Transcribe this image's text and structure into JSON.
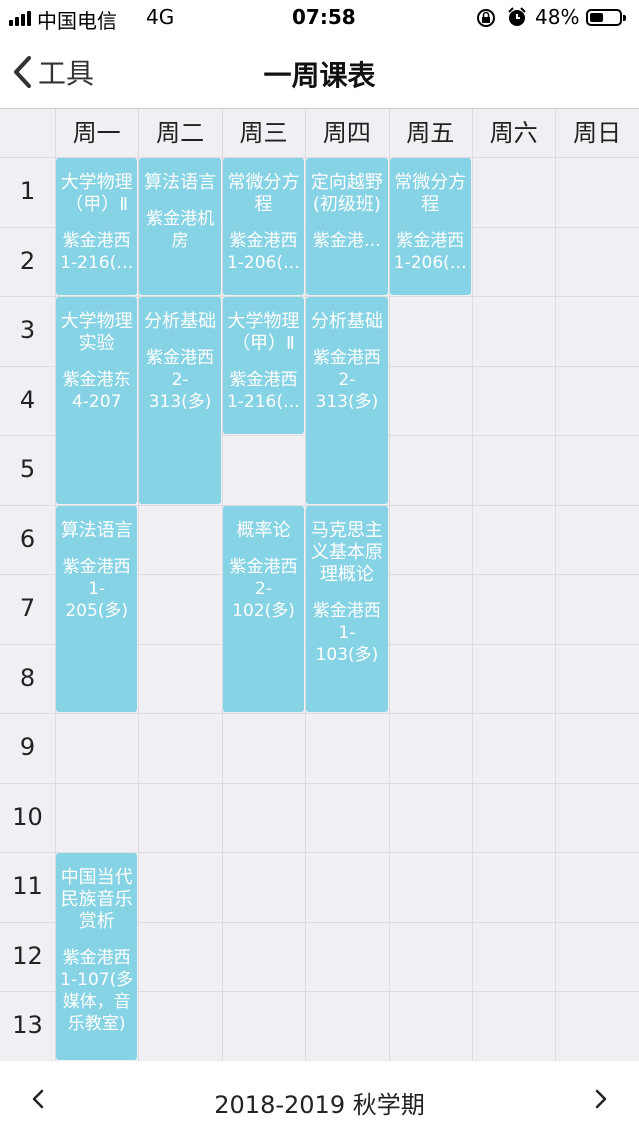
{
  "status": {
    "carrier": "中国电信",
    "network": "4G",
    "time": "07:58",
    "battery": "48%",
    "battery_level": 0.48
  },
  "nav": {
    "back_label": "工具",
    "title": "一周课表"
  },
  "days": [
    "周一",
    "周二",
    "周三",
    "周四",
    "周五",
    "周六",
    "周日"
  ],
  "periods": [
    "1",
    "2",
    "3",
    "4",
    "5",
    "6",
    "7",
    "8",
    "9",
    "10",
    "11",
    "12",
    "13"
  ],
  "courses": [
    {
      "day": 1,
      "start": 1,
      "end": 2,
      "name": "大学物理（甲）Ⅱ",
      "room": "紫金港西1-216(…"
    },
    {
      "day": 2,
      "start": 1,
      "end": 2,
      "name": "算法语言",
      "room": "紫金港机房"
    },
    {
      "day": 3,
      "start": 1,
      "end": 2,
      "name": "常微分方程",
      "room": "紫金港西1-206(…"
    },
    {
      "day": 4,
      "start": 1,
      "end": 2,
      "name": "定向越野(初级班)",
      "room": "紫金港…"
    },
    {
      "day": 5,
      "start": 1,
      "end": 2,
      "name": "常微分方程",
      "room": "紫金港西1-206(…"
    },
    {
      "day": 1,
      "start": 3,
      "end": 5,
      "name": "大学物理实验",
      "room": "紫金港东4-207"
    },
    {
      "day": 2,
      "start": 3,
      "end": 5,
      "name": "分析基础",
      "room": "紫金港西2-313(多)"
    },
    {
      "day": 3,
      "start": 3,
      "end": 4,
      "name": "大学物理（甲）Ⅱ",
      "room": "紫金港西1-216(…"
    },
    {
      "day": 4,
      "start": 3,
      "end": 5,
      "name": "分析基础",
      "room": "紫金港西2-313(多)"
    },
    {
      "day": 1,
      "start": 6,
      "end": 8,
      "name": "算法语言",
      "room": "紫金港西1-205(多)"
    },
    {
      "day": 3,
      "start": 6,
      "end": 8,
      "name": "概率论",
      "room": "紫金港西2-102(多)"
    },
    {
      "day": 4,
      "start": 6,
      "end": 8,
      "name": "马克思主义基本原理概论",
      "room": "紫金港西1-103(多)"
    },
    {
      "day": 1,
      "start": 11,
      "end": 13,
      "name": "中国当代民族音乐赏析",
      "room": "紫金港西1-107(多媒体，音乐教室)"
    }
  ],
  "footer": {
    "term": "2018-2019 秋学期"
  },
  "icons": {
    "back": "chevron-left-icon",
    "prev": "chevron-left-icon",
    "next": "chevron-right-icon",
    "alarm": "alarm-clock-icon",
    "lock": "rotation-lock-icon",
    "signal": "signal-icon",
    "battery": "battery-icon"
  },
  "colors": {
    "course_bg": "#86d3e5",
    "grid_bg": "#efeff4"
  }
}
